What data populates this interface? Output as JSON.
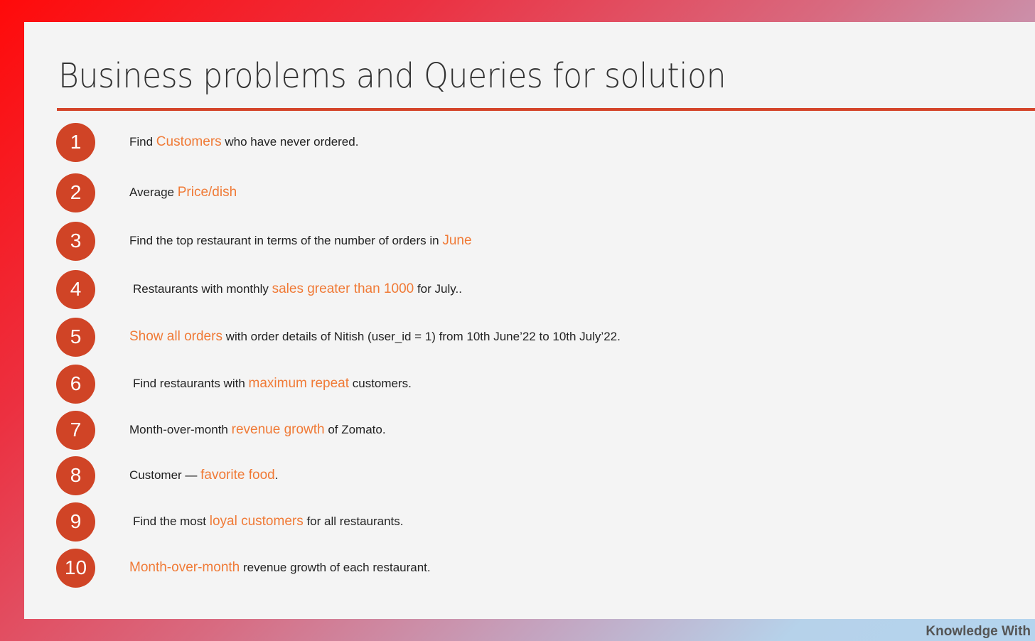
{
  "title": "Business problems and Queries for solution",
  "accent_color": "#d04426",
  "highlight_color": "#f07a36",
  "items": [
    {
      "number": "1",
      "parts": [
        {
          "t": "Find "
        },
        {
          "t": "Customers",
          "h": true
        },
        {
          "t": " who have never ordered."
        }
      ]
    },
    {
      "number": "2",
      "parts": [
        {
          "t": "Average "
        },
        {
          "t": "Price/dish",
          "h": true
        }
      ]
    },
    {
      "number": "3",
      "parts": [
        {
          "t": "Find the top restaurant in terms of the number of orders in "
        },
        {
          "t": "June",
          "h": true
        }
      ]
    },
    {
      "number": "4",
      "parts": [
        {
          "t": "Restaurants with monthly "
        },
        {
          "t": "sales greater than 1000",
          "h": true
        },
        {
          "t": " for July.."
        }
      ]
    },
    {
      "number": "5",
      "parts": [
        {
          "t": "Show all orders",
          "h": true
        },
        {
          "t": " with order details of Nitish (user_id = 1) from 10th June’22 to 10th July’22."
        }
      ]
    },
    {
      "number": "6",
      "parts": [
        {
          "t": "Find restaurants with "
        },
        {
          "t": "maximum repeat",
          "h": true
        },
        {
          "t": " customers."
        }
      ]
    },
    {
      "number": "7",
      "parts": [
        {
          "t": "Month-over-month "
        },
        {
          "t": "revenue growth",
          "h": true
        },
        {
          "t": " of Zomato."
        }
      ]
    },
    {
      "number": "8",
      "parts": [
        {
          "t": "Customer — "
        },
        {
          "t": "favorite food",
          "h": true
        },
        {
          "t": "."
        }
      ]
    },
    {
      "number": "9",
      "parts": [
        {
          "t": "Find the most "
        },
        {
          "t": "loyal customers",
          "h": true
        },
        {
          "t": " for all restaurants."
        }
      ]
    },
    {
      "number": "10",
      "parts": [
        {
          "t": "Month-over-month",
          "h": true
        },
        {
          "t": " revenue growth of each restaurant."
        }
      ]
    }
  ],
  "footer": "Knowledge With"
}
